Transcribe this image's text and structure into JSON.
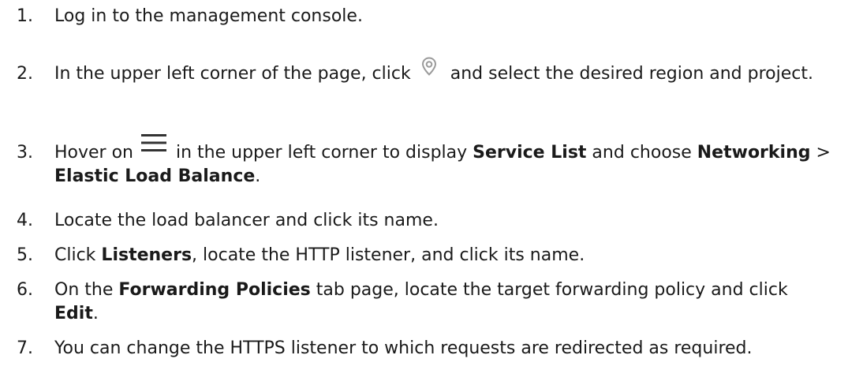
{
  "steps": [
    {
      "number": "1.",
      "parts": [
        {
          "t": "text",
          "v": "Log in to the management console."
        }
      ]
    },
    {
      "number": "2.",
      "parts": [
        {
          "t": "text",
          "v": "In the upper left corner of the page, click"
        },
        {
          "t": "icon",
          "v": "location-pin-icon"
        },
        {
          "t": "text",
          "v": "and select the desired region and project."
        }
      ]
    },
    {
      "number": "3.",
      "parts": [
        {
          "t": "text",
          "v": "Hover on"
        },
        {
          "t": "icon",
          "v": "hamburger-menu-icon"
        },
        {
          "t": "text",
          "v": "in the upper left corner to display "
        },
        {
          "t": "bold",
          "v": "Service List"
        },
        {
          "t": "text",
          "v": " and choose "
        },
        {
          "t": "bold",
          "v": "Networking"
        },
        {
          "t": "text",
          "v": " > "
        },
        {
          "t": "bold",
          "v": "Elastic Load Balance"
        },
        {
          "t": "text",
          "v": "."
        }
      ]
    },
    {
      "number": "4.",
      "parts": [
        {
          "t": "text",
          "v": "Locate the load balancer and click its name."
        }
      ]
    },
    {
      "number": "5.",
      "parts": [
        {
          "t": "text",
          "v": "Click "
        },
        {
          "t": "bold",
          "v": "Listeners"
        },
        {
          "t": "text",
          "v": ", locate the HTTP listener, and click its name."
        }
      ]
    },
    {
      "number": "6.",
      "parts": [
        {
          "t": "text",
          "v": "On the "
        },
        {
          "t": "bold",
          "v": "Forwarding Policies"
        },
        {
          "t": "text",
          "v": " tab page, locate the target forwarding policy and click "
        },
        {
          "t": "bold",
          "v": "Edit"
        },
        {
          "t": "text",
          "v": "."
        }
      ]
    },
    {
      "number": "7.",
      "parts": [
        {
          "t": "text",
          "v": "You can change the HTTPS listener to which requests are redirected as required."
        }
      ]
    }
  ],
  "colors": {
    "text": "#1a1a1a",
    "pin_icon": "#9a9a9a",
    "menu_icon": "#333333"
  }
}
